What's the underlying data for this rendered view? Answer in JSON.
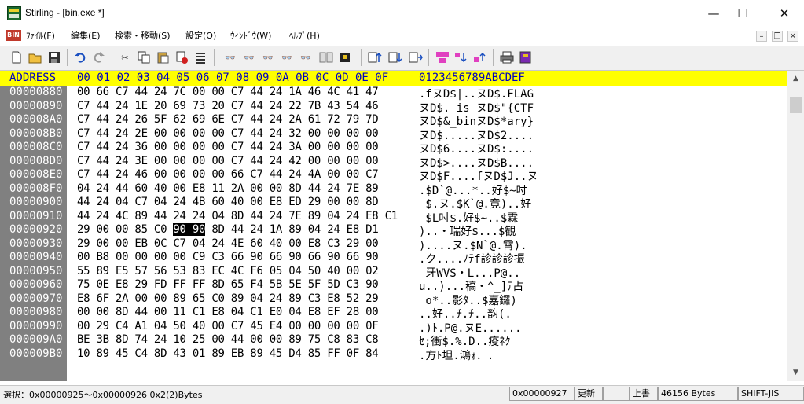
{
  "window": {
    "title": "Stirling - [bin.exe *]",
    "minimize": "—",
    "maximize": "☐",
    "close": "✕"
  },
  "menu": {
    "logo": "BIN",
    "items": [
      "ﾌｧｲﾙ(F)",
      "編集(E)",
      "検索・移動(S)",
      "設定(O)",
      "ｳｨﾝﾄﾞｳ(W)",
      "ﾍﾙﾌﾟ(H)"
    ],
    "mdi": [
      "–",
      "❐",
      "✕"
    ]
  },
  "toolbar": {
    "icons": [
      "new-file-icon",
      "open-folder-icon",
      "save-icon",
      "undo-icon",
      "redo-icon",
      "cut-icon",
      "copy-icon",
      "paste-icon",
      "delete-icon",
      "insert-lines-icon",
      "find-icon",
      "find-next-icon",
      "find-prev-icon",
      "find-replace-icon",
      "find-ab-icon",
      "compare-icon",
      "jump-icon",
      "goto-top-icon",
      "goto-bottom-icon",
      "goto-end-icon",
      "mark-icon",
      "mark-next-icon",
      "mark-prev-icon",
      "print-icon",
      "help-book-icon"
    ]
  },
  "hex": {
    "header": {
      "address": "ADDRESS",
      "bytes": "00 01 02 03 04 05 06 07 08 09 0A 0B 0C 0D 0E 0F",
      "ascii": "0123456789ABCDEF"
    },
    "rows": [
      {
        "addr": "00000880",
        "bytes": "00 66 C7 44 24 7C 00 00 C7 44 24 1A 46 4C 41 47",
        "ascii": ".fヌD$|..ヌD$.FLAG"
      },
      {
        "addr": "00000890",
        "bytes": "C7 44 24 1E 20 69 73 20 C7 44 24 22 7B 43 54 46",
        "ascii": "ヌD$. is ヌD$\"{CTF"
      },
      {
        "addr": "000008A0",
        "bytes": "C7 44 24 26 5F 62 69 6E C7 44 24 2A 61 72 79 7D",
        "ascii": "ヌD$&_binヌD$*ary}"
      },
      {
        "addr": "000008B0",
        "bytes": "C7 44 24 2E 00 00 00 00 C7 44 24 32 00 00 00 00",
        "ascii": "ヌD$.....ヌD$2...."
      },
      {
        "addr": "000008C0",
        "bytes": "C7 44 24 36 00 00 00 00 C7 44 24 3A 00 00 00 00",
        "ascii": "ヌD$6....ヌD$:...."
      },
      {
        "addr": "000008D0",
        "bytes": "C7 44 24 3E 00 00 00 00 C7 44 24 42 00 00 00 00",
        "ascii": "ヌD$>....ヌD$B...."
      },
      {
        "addr": "000008E0",
        "bytes": "C7 44 24 46 00 00 00 00 66 C7 44 24 4A 00 00 C7",
        "ascii": "ヌD$F....fヌD$J..ヌ"
      },
      {
        "addr": "000008F0",
        "bytes": "04 24 44 60 40 00 E8 11 2A 00 00 8D 44 24 7E 89",
        "ascii": ".$D`@...*..好$~吋"
      },
      {
        "addr": "00000900",
        "bytes": "44 24 04 C7 04 24 4B 60 40 00 E8 ED 29 00 00 8D",
        "ascii": " $.ヌ.$K`@.竟)..好"
      },
      {
        "addr": "00000910",
        "bytes": "44 24 4C 89 44 24 24 04 8D 44 24 7E 89 04 24 E8 C1",
        "ascii": " $L吋$.好$~..$霖"
      },
      {
        "addr": "00000920",
        "bytes": "29 00 00 85 C0 90 90 8D 44 24 1A 89 04 24 E8 D1",
        "ascii": ")..・瑞好$...$観"
      },
      {
        "addr": "00000930",
        "bytes": "29 00 00 EB 0C C7 04 24 4E 60 40 00 E8 C3 29 00",
        "ascii": ")....ヌ.$N`@.霄)."
      },
      {
        "addr": "00000940",
        "bytes": "00 B8 00 00 00 00 C9 C3 66 90 66 90 66 90 66 90",
        "ascii": ".ク....ﾉﾃf診診診振"
      },
      {
        "addr": "00000950",
        "bytes": "55 89 E5 57 56 53 83 EC 4C F6 05 04 50 40 00 02",
        "ascii": " 牙WVS・L...P@.."
      },
      {
        "addr": "00000960",
        "bytes": "75 0E E8 29 FD FF FF 8D 65 F4 5B 5E 5F 5D C3 90",
        "ascii": "u..)...稿・^_]ﾃ占"
      },
      {
        "addr": "00000970",
        "bytes": "E8 6F 2A 00 00 89 65 C0 89 04 24 89 C3 E8 52 29",
        "ascii": " o*..影ﾀ..$嘉鑼)"
      },
      {
        "addr": "00000980",
        "bytes": "00 00 8D 44 00 11 C1 E8 04 C1 E0 04 E8 EF 28 00",
        "ascii": "..好..ﾁ.ﾁ..韵(."
      },
      {
        "addr": "00000990",
        "bytes": "00 29 C4 A1 04 50 40 00 C7 45 E4 00 00 00 00 0F",
        "ascii": ".)ﾄ.P@.ヌE......"
      },
      {
        "addr": "000009A0",
        "bytes": "BE 3B 8D 74 24 10 25 00 44 00 00 89 75 C8 83 C8",
        "ascii": "ｾ;衝$.%.D..疫ﾈｸ"
      },
      {
        "addr": "000009B0",
        "bytes": "10 89 45 C4 8D 43 01 89 EB 89 45 D4 85 FF 0F 84",
        "ascii": ".方ﾄ坦.鴻ｫ．. "
      }
    ]
  },
  "status": {
    "selection": "選択：0x00000925～0x00000926  0x2(2)Bytes",
    "cursor": "0x00000927",
    "mode1": "更新",
    "mode2": "上書",
    "size": "46156 Bytes",
    "encoding": "SHIFT-JIS"
  },
  "colors": {
    "header_bg": "#ffff00",
    "header_text": "#0000c0",
    "address_bg": "#808080",
    "selection_bg": "#000000"
  }
}
